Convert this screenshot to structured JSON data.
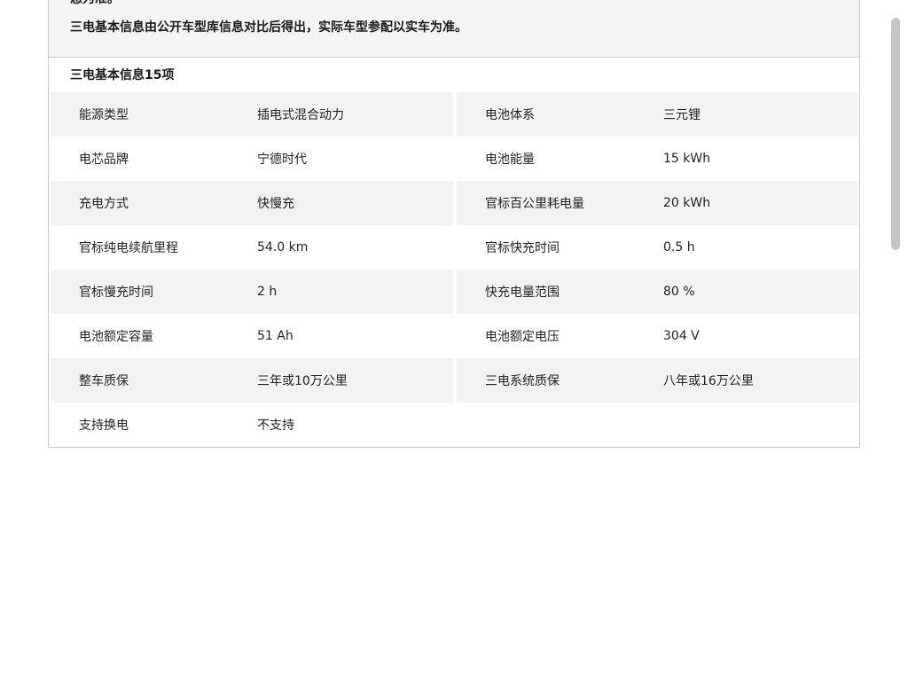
{
  "notice": {
    "line1": "息为准。",
    "line2": "三电基本信息由公开车型库信息对比后得出，实际车型参配以实车为准。"
  },
  "section": {
    "title": "三电基本信息15项"
  },
  "rows": [
    {
      "left_label": "能源类型",
      "left_value": "插电式混合动力",
      "right_label": "电池体系",
      "right_value": "三元锂"
    },
    {
      "left_label": "电芯品牌",
      "left_value": "宁德时代",
      "right_label": "电池能量",
      "right_value": "15 kWh"
    },
    {
      "left_label": "充电方式",
      "left_value": "快慢充",
      "right_label": "官标百公里耗电量",
      "right_value": "20 kWh"
    },
    {
      "left_label": "官标纯电续航里程",
      "left_value": "54.0 km",
      "right_label": "官标快充时间",
      "right_value": "0.5 h"
    },
    {
      "left_label": "官标慢充时间",
      "left_value": "2 h",
      "right_label": "快充电量范围",
      "right_value": "80 %"
    },
    {
      "left_label": "电池额定容量",
      "left_value": "51 Ah",
      "right_label": "电池额定电压",
      "right_value": "304 V"
    },
    {
      "left_label": "整车质保",
      "left_value": "三年或10万公里",
      "right_label": "三电系统质保",
      "right_value": "八年或16万公里"
    },
    {
      "left_label": "支持换电",
      "left_value": "不支持"
    }
  ]
}
